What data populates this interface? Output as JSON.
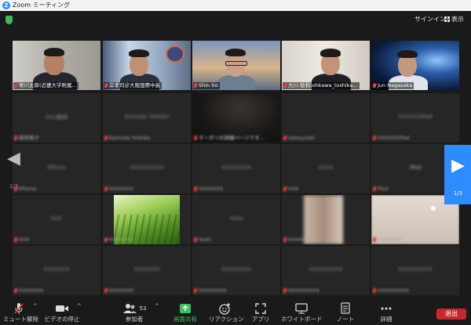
{
  "window": {
    "title": "Zoom ミーティング"
  },
  "topbar": {
    "sign_in": "サインイン",
    "view": "表示"
  },
  "row1": [
    {
      "label": "寄川太郎(近畿大学附属…"
    },
    {
      "label": "岸孝司＠大阪国際中高"
    },
    {
      "label": "Shin Ito"
    },
    {
      "label": "大川 稔和(ohkawa_toshika…"
    },
    {
      "label": "Jun Nagasaka"
    }
  ],
  "pager": {
    "left_page": "1/3",
    "right_page": "1/3"
  },
  "row2": [
    {
      "center": "OYU教師",
      "label": "藤原朝子"
    },
    {
      "center": "Kamada Yoshiko",
      "label": "Kamada Yoshiko"
    },
    {
      "center": "",
      "label": "オーダリの詳細ページです…"
    },
    {
      "center": "",
      "label": "sawayaaki"
    },
    {
      "center": "XXXXXXiPad",
      "label": "XXXXXXiPad"
    }
  ],
  "row3": [
    {
      "center": "iPhone",
      "label": "iPhone"
    },
    {
      "center": "XXXXXXXXX",
      "label": "XXXXXXX"
    },
    {
      "center": "XXXXXXXX",
      "label": "XXXXXXX"
    },
    {
      "center": "XXXX",
      "label": "XXX"
    },
    {
      "center": "iPad",
      "label": "iPad"
    }
  ],
  "row4": [
    {
      "center": "XXX",
      "label": "XXX"
    },
    {
      "center": "",
      "label": "XXXXXXX"
    },
    {
      "center": "Yoshi",
      "label": "Yoshi"
    },
    {
      "center": "",
      "label": "XXXXXXX"
    },
    {
      "center": "",
      "label": "XXXXXXX"
    }
  ],
  "row5": [
    {
      "center": "XXXXXXX",
      "label": "XXXXXXX"
    },
    {
      "center": "XXXXXXX",
      "label": "XXXXXXX"
    },
    {
      "center": "XXXXXXXX",
      "label": "XXXXXXXX"
    },
    {
      "center": "XXXXXXXXX",
      "label": "XXXXXXXXX"
    },
    {
      "center": "XXXXXXXXX",
      "label": "XXXXXXXXX"
    }
  ],
  "toolbar": {
    "mute": "ミュート解除",
    "video": "ビデオの停止",
    "participants": "参加者",
    "participants_count": "53",
    "share": "画面共有",
    "reactions": "リアクション",
    "apps": "アプリ",
    "whiteboard": "ホワイトボード",
    "notes": "ノート",
    "more": "詳細",
    "end": "退出"
  },
  "colors": {
    "active_speaker": "#c8e33a",
    "share_green": "#39c15b",
    "end_red": "#c8282d",
    "nav_blue": "#2d8cff"
  }
}
